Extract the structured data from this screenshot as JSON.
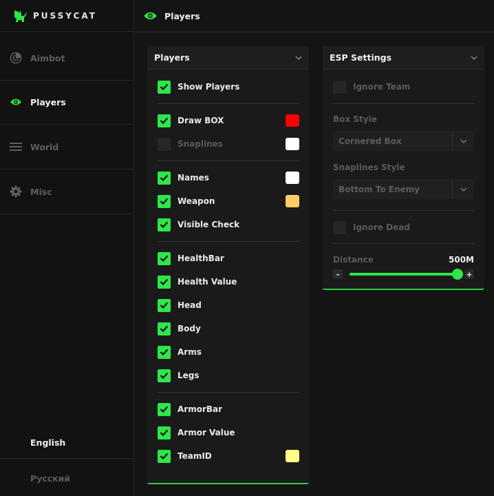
{
  "brand": {
    "name": "PUSSYCAT"
  },
  "sidebar": {
    "items": [
      {
        "label": "Aimbot",
        "icon": "aimbot-icon",
        "active": false
      },
      {
        "label": "Players",
        "icon": "eye-icon",
        "active": true
      },
      {
        "label": "World",
        "icon": "menu-lines-icon",
        "active": false
      },
      {
        "label": "Misc",
        "icon": "gear-icon",
        "active": false
      }
    ],
    "languages": [
      {
        "label": "English",
        "active": true
      },
      {
        "label": "Русский",
        "active": false
      }
    ]
  },
  "header": {
    "title": "Players",
    "icon": "eye-icon"
  },
  "players_panel": {
    "title": "Players",
    "options": [
      {
        "label": "Show Players",
        "checked": true
      },
      {
        "label": "Draw BOX",
        "checked": true,
        "color": "#ff0000"
      },
      {
        "label": "Snaplines",
        "checked": false,
        "color": "#ffffff"
      },
      {
        "label": "Names",
        "checked": true,
        "color": "#ffffff"
      },
      {
        "label": "Weapon",
        "checked": true,
        "color": "#ffcc66"
      },
      {
        "label": "Visible Check",
        "checked": true
      },
      {
        "label": "HealthBar",
        "checked": true
      },
      {
        "label": "Health Value",
        "checked": true
      },
      {
        "label": "Head",
        "checked": true
      },
      {
        "label": "Body",
        "checked": true
      },
      {
        "label": "Arms",
        "checked": true
      },
      {
        "label": "Legs",
        "checked": true
      },
      {
        "label": "ArmorBar",
        "checked": true
      },
      {
        "label": "Armor Value",
        "checked": true
      },
      {
        "label": "TeamID",
        "checked": true,
        "color": "#ffff88"
      }
    ]
  },
  "esp_panel": {
    "title": "ESP Settings",
    "ignore_team": {
      "label": "Ignore Team",
      "checked": false
    },
    "box_style": {
      "label": "Box Style",
      "value": "Cornered Box"
    },
    "snaplines_style": {
      "label": "Snaplines Style",
      "value": "Bottom To Enemy"
    },
    "ignore_dead": {
      "label": "Ignore Dead",
      "checked": false
    },
    "distance": {
      "label": "Distance",
      "value_text": "500M",
      "fraction": 1.0,
      "minus": "-",
      "plus": "+"
    }
  },
  "colors": {
    "accent": "#2ee64a",
    "background": "#141414",
    "panel": "#1a1a1a"
  }
}
